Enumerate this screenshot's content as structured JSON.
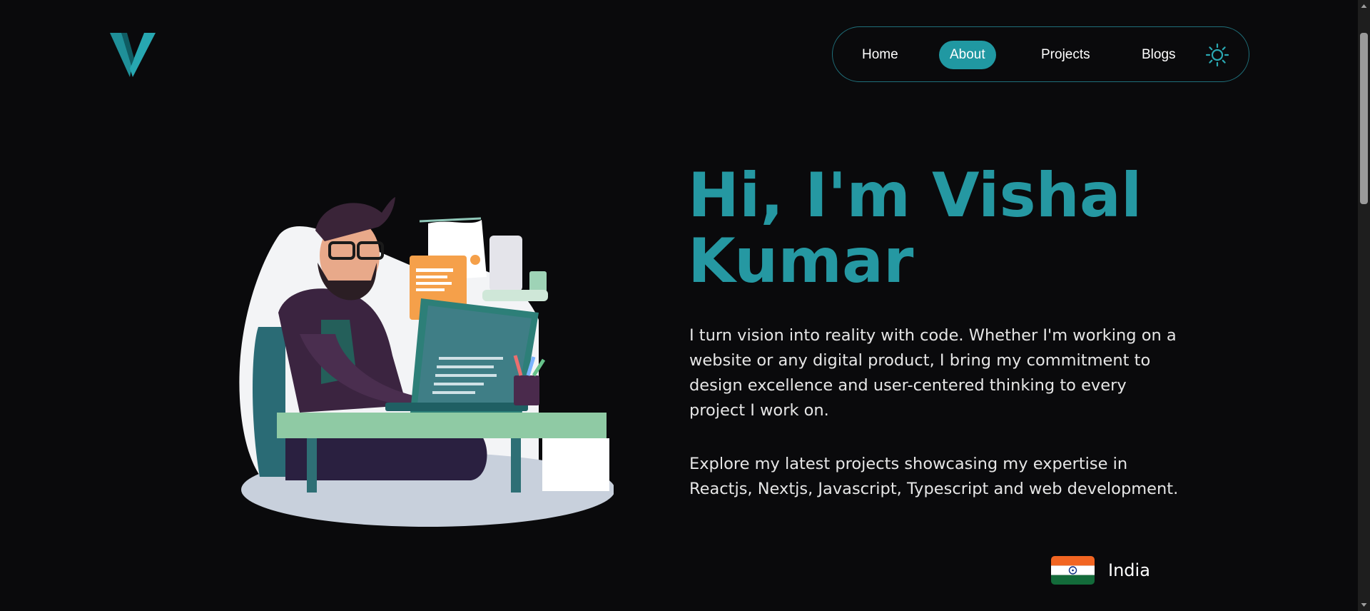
{
  "header": {
    "logo_icon": "v-letter-logo",
    "nav": [
      {
        "label": "Home",
        "active": false
      },
      {
        "label": "About",
        "active": true
      },
      {
        "label": "Projects",
        "active": false
      },
      {
        "label": "Blogs",
        "active": false
      }
    ],
    "theme_icon": "sun-icon"
  },
  "hero": {
    "title": "Hi, I'm Vishal Kumar",
    "paragraph_1": "I turn vision into reality with code. Whether I'm working on a website or any digital product, I bring my commitment to design excellence and user-centered thinking to every project I work on.",
    "paragraph_2": "Explore my latest projects showcasing my expertise in Reactjs, Nextjs, Javascript, Typescript and web development.",
    "location": {
      "flag_icon": "india-flag-icon",
      "label": "India"
    }
  },
  "colors": {
    "background": "#0a0a0c",
    "accent": "#2598a2",
    "nav_active_bg": "#2098a2",
    "nav_border": "#1f6f7a",
    "text": "#e6e6e6"
  }
}
